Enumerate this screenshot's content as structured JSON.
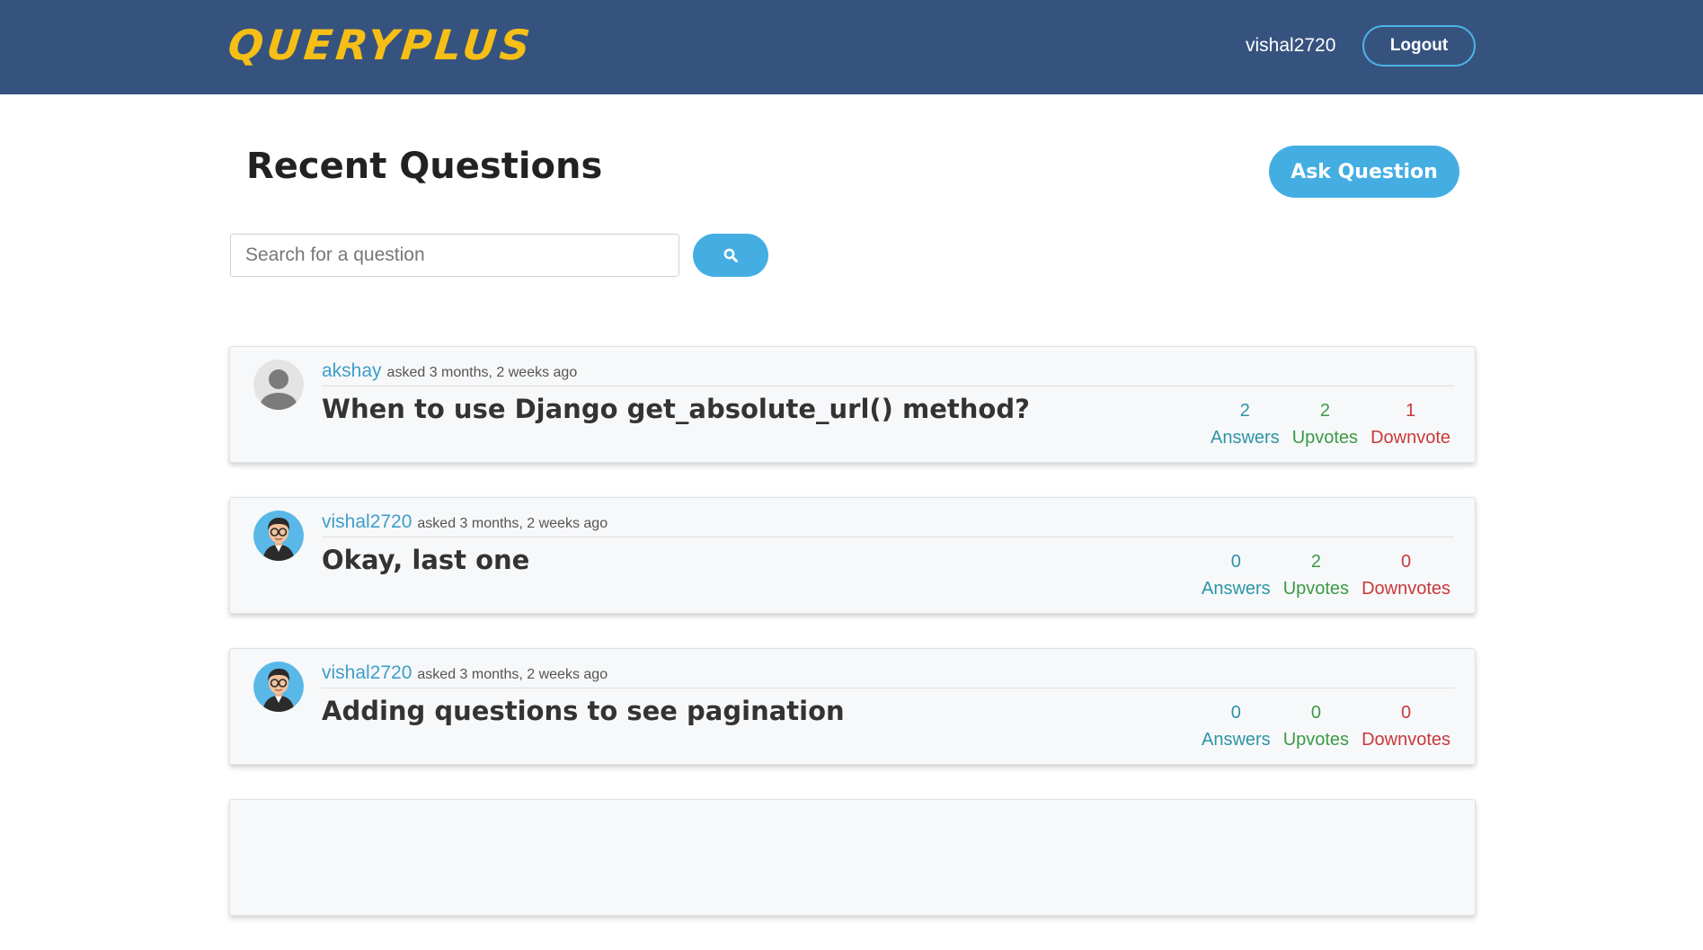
{
  "navbar": {
    "logo": "QUERYPLUS",
    "username": "vishal2720",
    "logout_label": "Logout"
  },
  "page": {
    "title": "Recent Questions",
    "ask_label": "Ask Question"
  },
  "search": {
    "placeholder": "Search for a question",
    "button_icon": "search-icon"
  },
  "colors": {
    "navbar": "#36537f",
    "logo": "#f6bf16",
    "accent": "#44aee3",
    "answers": "#2c95a8",
    "upvotes": "#3a9a47",
    "downvotes": "#c8393b"
  },
  "questions": [
    {
      "author": "akshay",
      "asked": "asked 3 months, 2 weeks ago",
      "title": "When to use Django get_absolute_url() method?",
      "answers": "2",
      "answers_label": "Answers",
      "upvotes": "2",
      "upvotes_label": "Upvotes",
      "downvotes": "1",
      "downvotes_label": "Downvote",
      "avatar": "default-user-avatar"
    },
    {
      "author": "vishal2720",
      "asked": "asked 3 months, 2 weeks ago",
      "title": "Okay, last one",
      "answers": "0",
      "answers_label": "Answers",
      "upvotes": "2",
      "upvotes_label": "Upvotes",
      "downvotes": "0",
      "downvotes_label": "Downvotes",
      "avatar": "cartoon-user-avatar"
    },
    {
      "author": "vishal2720",
      "asked": "asked 3 months, 2 weeks ago",
      "title": "Adding questions to see pagination",
      "answers": "0",
      "answers_label": "Answers",
      "upvotes": "0",
      "upvotes_label": "Upvotes",
      "downvotes": "0",
      "downvotes_label": "Downvotes",
      "avatar": "cartoon-user-avatar"
    }
  ]
}
